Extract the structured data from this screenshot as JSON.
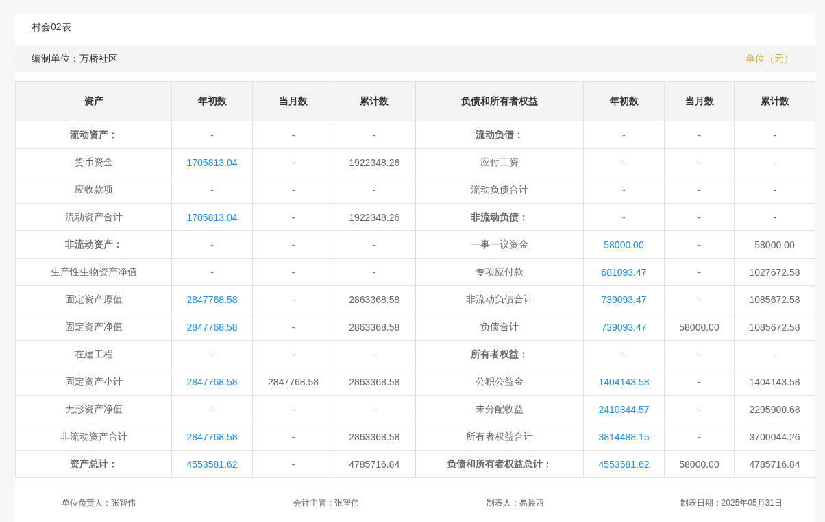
{
  "title": "村会02表",
  "info_bar": {
    "unit_label": "编制单位：万桥社区",
    "currency": "单位（元）"
  },
  "table": {
    "columns": [
      {
        "label": "资产",
        "kind": "label"
      },
      {
        "label": "年初数",
        "kind": "link"
      },
      {
        "label": "当月数",
        "kind": "plain"
      },
      {
        "label": "累计数",
        "kind": "plain"
      },
      {
        "label": "负债和所有者权益",
        "kind": "label"
      },
      {
        "label": "年初数",
        "kind": "link"
      },
      {
        "label": "当月数",
        "kind": "plain"
      },
      {
        "label": "累计数",
        "kind": "plain"
      }
    ],
    "rows": [
      {
        "cells": [
          "流动资产：",
          "-",
          "-",
          "-",
          "流动负债：",
          "-",
          "-",
          "-"
        ],
        "left_heading": true,
        "right_heading": true
      },
      {
        "cells": [
          "货币资金",
          "1705813.04",
          "-",
          "1922348.26",
          "应付工资",
          "-",
          "-",
          "-"
        ],
        "left_heading": false,
        "right_heading": false
      },
      {
        "cells": [
          "应收款项",
          "-",
          "-",
          "-",
          "流动负债合计",
          "-",
          "-",
          "-"
        ],
        "left_heading": false,
        "right_heading": false
      },
      {
        "cells": [
          "流动资产合计",
          "1705813.04",
          "-",
          "1922348.26",
          "非流动负债：",
          "-",
          "-",
          "-"
        ],
        "left_heading": false,
        "right_heading": true
      },
      {
        "cells": [
          "非流动资产：",
          "-",
          "-",
          "-",
          "一事一议资金",
          "58000.00",
          "-",
          "58000.00"
        ],
        "left_heading": true,
        "right_heading": false
      },
      {
        "cells": [
          "生产性生物资产净值",
          "-",
          "-",
          "-",
          "专项应付款",
          "681093.47",
          "-",
          "1027672.58"
        ],
        "left_heading": false,
        "right_heading": false
      },
      {
        "cells": [
          "固定资产原值",
          "2847768.58",
          "-",
          "2863368.58",
          "非流动负债合计",
          "739093.47",
          "-",
          "1085672.58"
        ],
        "left_heading": false,
        "right_heading": false
      },
      {
        "cells": [
          "固定资产净值",
          "2847768.58",
          "-",
          "2863368.58",
          "负债合计",
          "739093.47",
          "58000.00",
          "1085672.58"
        ],
        "left_heading": false,
        "right_heading": false
      },
      {
        "cells": [
          "在建工程",
          "-",
          "-",
          "-",
          "所有者权益：",
          "-",
          "-",
          "-"
        ],
        "left_heading": false,
        "right_heading": true
      },
      {
        "cells": [
          "固定资产小计",
          "2847768.58",
          "2847768.58",
          "2863368.58",
          "公积公益金",
          "1404143.58",
          "-",
          "1404143.58"
        ],
        "left_heading": false,
        "right_heading": false
      },
      {
        "cells": [
          "无形资产净值",
          "-",
          "-",
          "-",
          "未分配收益",
          "2410344.57",
          "-",
          "2295900.68"
        ],
        "left_heading": false,
        "right_heading": false
      },
      {
        "cells": [
          "非流动资产合计",
          "2847768.58",
          "-",
          "2863368.58",
          "所有者权益合计",
          "3814488.15",
          "-",
          "3700044.26"
        ],
        "left_heading": false,
        "right_heading": false
      },
      {
        "cells": [
          "资产总计：",
          "4553581.62",
          "-",
          "4785716.84",
          "负债和所有者权益总计：",
          "4553581.62",
          "58000.00",
          "4785716.84"
        ],
        "left_heading": true,
        "right_heading": true
      }
    ]
  },
  "signatures": [
    "单位负责人：张智伟",
    "会计主管：张智伟",
    "制表人：易晨西",
    "制表日期：2025年05月31日"
  ]
}
